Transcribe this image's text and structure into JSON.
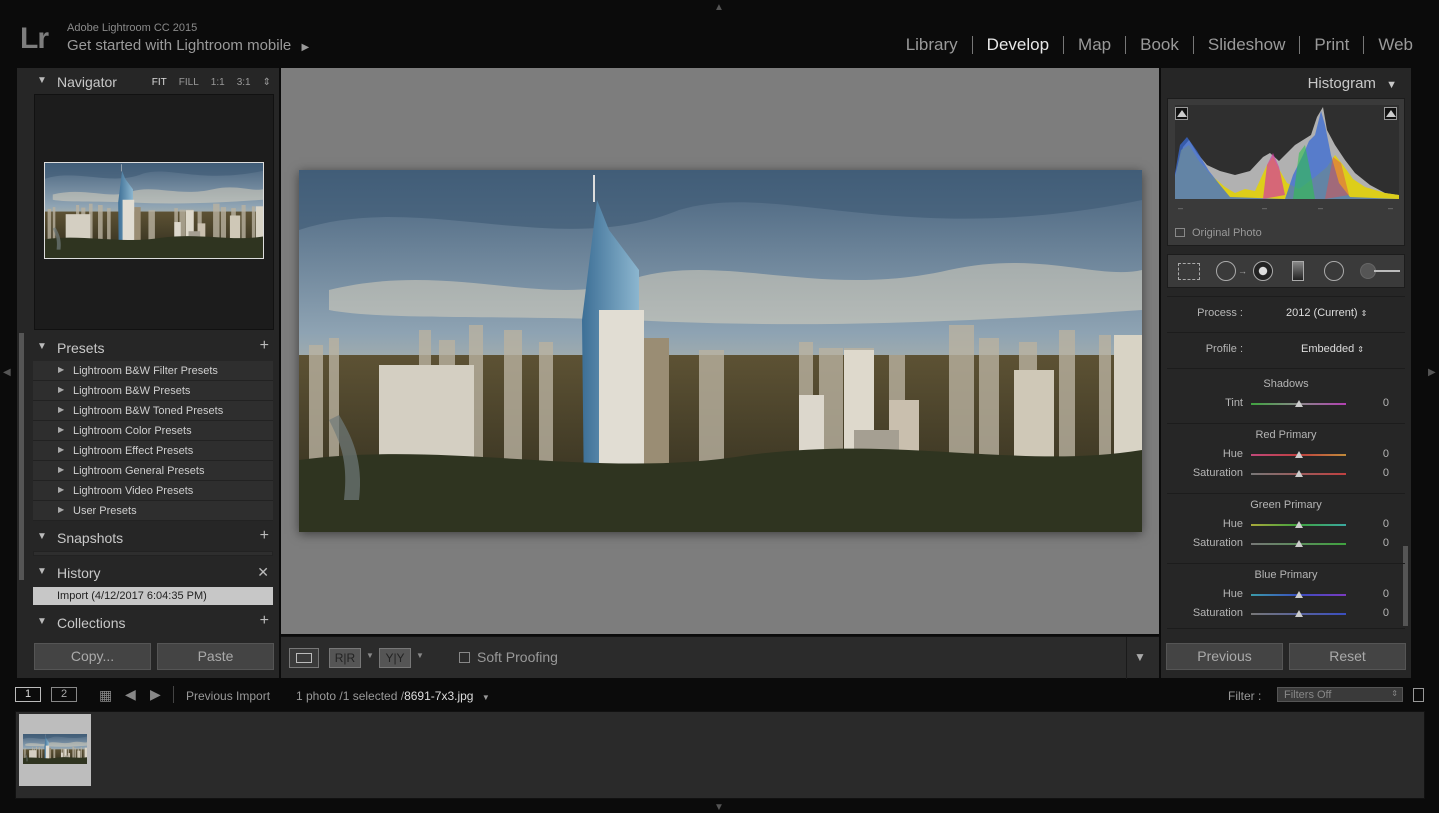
{
  "header": {
    "app_name": "Adobe Lightroom CC 2015",
    "mobile_link": "Get started with Lightroom mobile",
    "mobile_arrow": "▶",
    "logo": "Lr",
    "modules": [
      "Library",
      "Develop",
      "Map",
      "Book",
      "Slideshow",
      "Print",
      "Web"
    ],
    "active_module": "Develop"
  },
  "navigator": {
    "title": "Navigator",
    "modes": [
      "FIT",
      "FILL",
      "1:1",
      "3:1"
    ],
    "active_mode": "FIT"
  },
  "presets": {
    "title": "Presets",
    "items": [
      "Lightroom B&W Filter Presets",
      "Lightroom B&W Presets",
      "Lightroom B&W Toned Presets",
      "Lightroom Color Presets",
      "Lightroom Effect Presets",
      "Lightroom General Presets",
      "Lightroom Video Presets",
      "User Presets"
    ]
  },
  "snapshots": {
    "title": "Snapshots"
  },
  "history": {
    "title": "History",
    "items": [
      "Import (4/12/2017 6:04:35 PM)"
    ]
  },
  "collections": {
    "title": "Collections"
  },
  "left_buttons": {
    "copy": "Copy...",
    "paste": "Paste"
  },
  "toolbar": {
    "soft_proofing": "Soft Proofing"
  },
  "histogram": {
    "title": "Histogram",
    "original_photo": "Original Photo",
    "ticks": [
      "–",
      "–",
      "–",
      "–"
    ]
  },
  "develop": {
    "process_label": "Process :",
    "process_value": "2012 (Current)",
    "profile_label": "Profile :",
    "profile_value": "Embedded",
    "groups": [
      {
        "title": "Shadows",
        "sliders": [
          {
            "label": "Tint",
            "value": "0",
            "track": "tint"
          }
        ]
      },
      {
        "title": "Red Primary",
        "sliders": [
          {
            "label": "Hue",
            "value": "0",
            "track": "redhue"
          },
          {
            "label": "Saturation",
            "value": "0",
            "track": "redsat"
          }
        ]
      },
      {
        "title": "Green Primary",
        "sliders": [
          {
            "label": "Hue",
            "value": "0",
            "track": "greenhue"
          },
          {
            "label": "Saturation",
            "value": "0",
            "track": "greensat"
          }
        ]
      },
      {
        "title": "Blue Primary",
        "sliders": [
          {
            "label": "Hue",
            "value": "0",
            "track": "bluehue"
          },
          {
            "label": "Saturation",
            "value": "0",
            "track": "bluesat"
          }
        ]
      }
    ]
  },
  "right_buttons": {
    "previous": "Previous",
    "reset": "Reset"
  },
  "filmstrip": {
    "screen1": "1",
    "screen2": "2",
    "source": "Previous Import",
    "count": "1 photo /1 selected /",
    "filename": "8691-7x3.jpg",
    "filter_label": "Filter :",
    "filter_value": "Filters Off"
  },
  "colors": {
    "accent": "#e8e8e8",
    "panel": "#262626",
    "canvas": "#7d7d7d"
  }
}
